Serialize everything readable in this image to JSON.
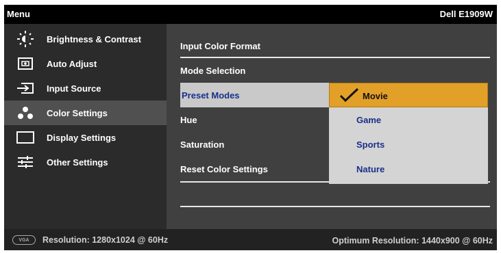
{
  "header": {
    "title": "Menu",
    "model": "Dell E1909W"
  },
  "sidebar": {
    "items": [
      {
        "label": "Brightness & Contrast",
        "icon": "brightness-icon"
      },
      {
        "label": "Auto Adjust",
        "icon": "auto-adjust-icon"
      },
      {
        "label": "Input Source",
        "icon": "input-source-icon"
      },
      {
        "label": "Color Settings",
        "icon": "color-settings-icon"
      },
      {
        "label": "Display Settings",
        "icon": "display-settings-icon"
      },
      {
        "label": "Other Settings",
        "icon": "other-settings-icon"
      }
    ],
    "active": "Color Settings"
  },
  "color_settings": {
    "rows": [
      {
        "label": "Input Color Format"
      },
      {
        "label": "Mode Selection"
      },
      {
        "label": "Preset Modes"
      },
      {
        "label": "Hue"
      },
      {
        "label": "Saturation"
      },
      {
        "label": "Reset Color Settings"
      }
    ],
    "active_row": "Preset Modes"
  },
  "preset_modes": {
    "options": [
      "Movie",
      "Game",
      "Sports",
      "Nature"
    ],
    "selected": "Movie"
  },
  "footer": {
    "connector": "VGA",
    "resolution": "Resolution: 1280x1024 @ 60Hz",
    "optimum": "Optimum Resolution: 1440x900 @ 60Hz"
  },
  "colors": {
    "highlight": "#e3a028",
    "active_text": "#1a2f8a",
    "panel": "#404040",
    "sidebar": "#2b2b2b"
  }
}
